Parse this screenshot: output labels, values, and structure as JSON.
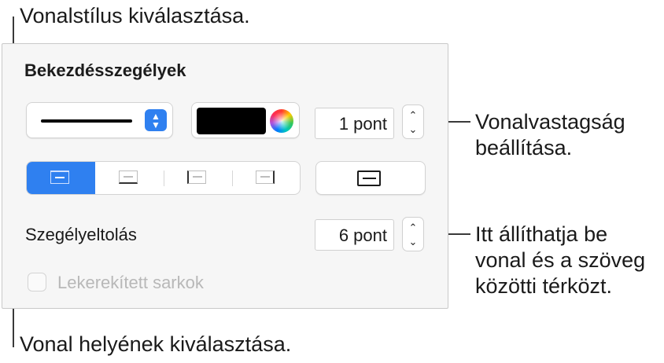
{
  "callouts": {
    "line_style": "Vonalstílus kiválasztása.",
    "line_width": [
      "Vonalvastagság",
      "beállítása."
    ],
    "offset": [
      "Itt állíthatja be",
      "vonal és a szöveg",
      "közötti térközt."
    ],
    "line_position": "Vonal helyének kiválasztása."
  },
  "panel": {
    "title": "Bekezdésszegélyek",
    "line_style_control": {
      "selected": "solid line",
      "icon": "popup-arrows-icon"
    },
    "color": {
      "swatch": "#000000",
      "icon": "color-wheel-icon"
    },
    "width_value": "1 pont",
    "position_segments": [
      {
        "name": "top-border",
        "selected": true
      },
      {
        "name": "bottom-border",
        "selected": false
      },
      {
        "name": "left-border",
        "selected": false
      },
      {
        "name": "right-border",
        "selected": false
      }
    ],
    "all_borders_icon": "box-border-icon",
    "offset_label": "Szegélyeltolás",
    "offset_value": "6 pont",
    "rounded_corners": {
      "label": "Lekerekített sarkok",
      "checked": false,
      "enabled": false
    }
  },
  "colors": {
    "accent": "#2f80f0",
    "panel_bg": "#f6f6f6"
  }
}
